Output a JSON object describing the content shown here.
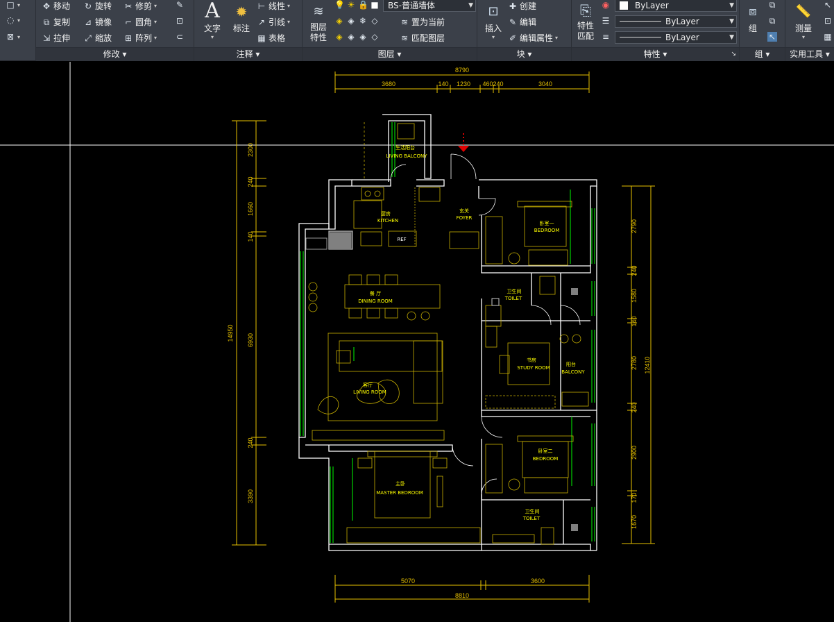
{
  "ribbon": {
    "modify": {
      "items": [
        {
          "label": "移动",
          "icon": "move-icon"
        },
        {
          "label": "旋转",
          "icon": "rotate-icon"
        },
        {
          "label": "修剪",
          "icon": "trim-icon"
        },
        {
          "label": "复制",
          "icon": "copy-icon"
        },
        {
          "label": "镜像",
          "icon": "mirror-icon"
        },
        {
          "label": "圆角",
          "icon": "fillet-icon"
        },
        {
          "label": "拉伸",
          "icon": "stretch-icon"
        },
        {
          "label": "缩放",
          "icon": "scale-icon"
        },
        {
          "label": "阵列",
          "icon": "array-icon"
        }
      ],
      "title": "修改"
    },
    "annotation": {
      "text": "文字",
      "dimension": "标注",
      "linear": "线性",
      "leader": "引线",
      "table": "表格",
      "title": "注释"
    },
    "layers": {
      "layer_properties": "图层\n特性",
      "current_layer": "BS-普通墙体",
      "set_current": "置为当前",
      "match_layer": "匹配图层",
      "title": "图层"
    },
    "block": {
      "insert": "插入",
      "create": "创建",
      "edit": "编辑",
      "edit_attributes": "编辑属性",
      "title": "块"
    },
    "properties": {
      "match": "特性\n匹配",
      "color": "ByLayer",
      "linetype": "ByLayer",
      "lineweight": "ByLayer",
      "title": "特性"
    },
    "groups": {
      "group": "组",
      "title": "组"
    },
    "utilities": {
      "measure": "测量",
      "title": "实用工具"
    }
  },
  "drawing": {
    "colors": {
      "wall": "#ffffff",
      "dimension": "#e8c200",
      "furniture": "#c8b000",
      "window": "#00d000",
      "gray_fill": "#808080",
      "label": "#ffff00",
      "marker": "#e00000"
    },
    "top_dims": {
      "overall": "8790",
      "segments": [
        "3680",
        "140",
        "1230",
        "460",
        "240",
        "3040"
      ]
    },
    "bottom_dims": {
      "overall": "8810",
      "segments": [
        "5070",
        "3600"
      ]
    },
    "left_dims": {
      "overall": "14950",
      "segments": [
        "2300",
        "240",
        "1660",
        "140",
        "6930",
        "240",
        "3390"
      ]
    },
    "right_dims": {
      "overall": "12410",
      "segments": [
        "2790",
        "240",
        "1580",
        "140",
        "2780",
        "240",
        "2900",
        "170",
        "1670"
      ]
    },
    "rooms": [
      {
        "zh": "生活阳台",
        "en": "LIVING BALCONY"
      },
      {
        "zh": "厨房",
        "en": "KITCHEN"
      },
      {
        "zh": "玄关",
        "en": "FOYER"
      },
      {
        "zh": "卧室一",
        "en": "BEDROOM"
      },
      {
        "zh": "餐  厅",
        "en": "DINING ROOM"
      },
      {
        "zh": "卫生间",
        "en": "TOILET"
      },
      {
        "zh": "书房",
        "en": "STUDY ROOM"
      },
      {
        "zh": "阳台",
        "en": "BALCONY"
      },
      {
        "zh": "客厅",
        "en": "LIVING ROOM"
      },
      {
        "zh": "卧室二",
        "en": "BEDROOM"
      },
      {
        "zh": "主卧",
        "en": "MASTER BEDROOM"
      },
      {
        "zh": "卫生间",
        "en": "TOILET"
      }
    ],
    "ref_label": "REF"
  }
}
